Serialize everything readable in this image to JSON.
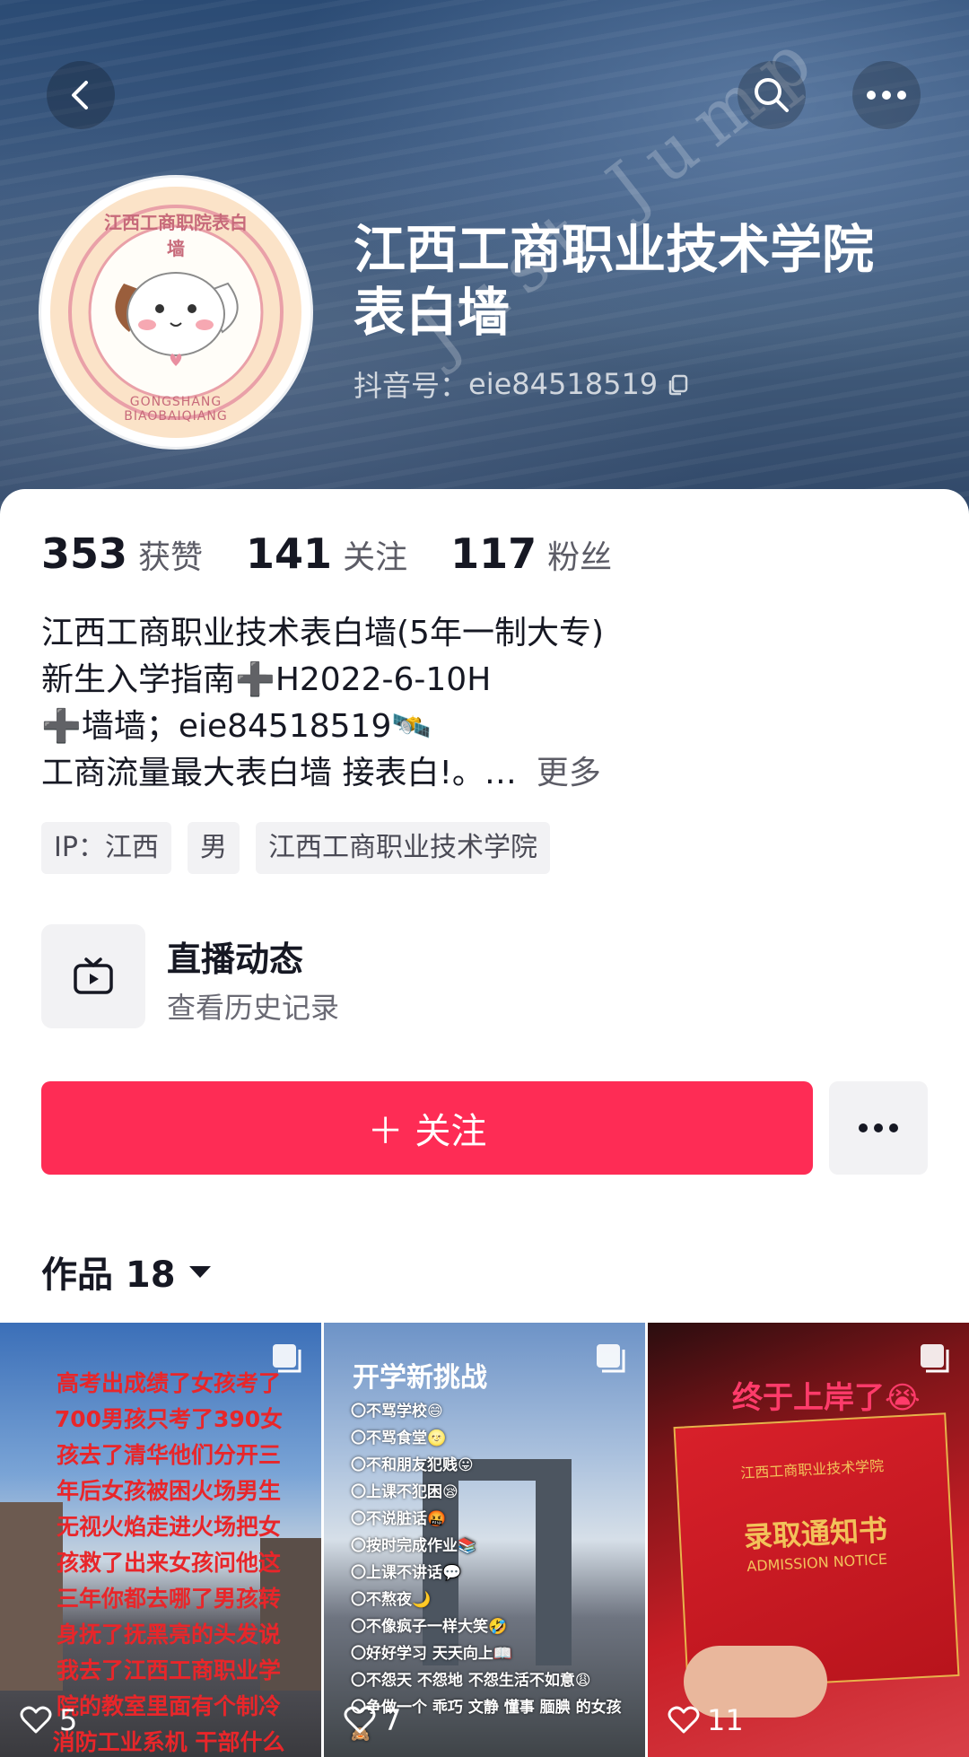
{
  "header": {
    "title_line1": "江西工商职业技术学院",
    "title_line2": "表白墙",
    "douyin_id_label": "抖音号：",
    "douyin_id_value": "eie84518519",
    "watermark": "Just Jump",
    "back_icon": "back-arrow-icon",
    "search_icon": "search-icon",
    "more_icon": "more-dots-icon",
    "avatar": {
      "top_text": "江西工商职院表白墙",
      "bottom_text": "GONGSHANG BIAOBAIQIANG"
    }
  },
  "stats": [
    {
      "value": "353",
      "label": "获赞"
    },
    {
      "value": "141",
      "label": "关注"
    },
    {
      "value": "117",
      "label": "粉丝"
    }
  ],
  "bio": {
    "line1": "江西工商职业技术表白墙(5年一制大专)",
    "line2": "新生入学指南➕H2022-6-10H",
    "line3": "➕墙墙；eie84518519🛰️",
    "line4": "工商流量最大表白墙  接表白!。…",
    "more_label": "更多"
  },
  "tags": [
    "IP：江西",
    "男",
    "江西工商职业技术学院"
  ],
  "live": {
    "title": "直播动态",
    "subtitle": "查看历史记录"
  },
  "actions": {
    "follow_label": "＋ 关注"
  },
  "works": {
    "tab_label": "作品 18",
    "items": [
      {
        "likes": "5",
        "overlay_text": "高考出成绩了女孩考了700男孩只考了390女孩去了清华他们分开三年后女孩被困火场男生无视火焰走进火场把女孩救了出来女孩问他这三年你都去哪了男孩转身抚了抚黑亮的头发说我去了江西工商职业学院的教室里面有个制冷消防工业系机 干部什么卫生间"
      },
      {
        "likes": "7",
        "heading": "开学新挑战",
        "list": [
          "〇不骂学校😄",
          "〇不骂食堂🌝",
          "〇不和朋友犯贱😛",
          "〇上课不犯困😪",
          "〇不说脏话🤬",
          "〇按时完成作业📚",
          "〇上课不讲话💬",
          "〇不熬夜🌙",
          "〇不像疯子一样大笑🤣",
          "〇好好学习 天天向上📖",
          "〇不怨天 不怨地 不怨生活不如意😩",
          "〇争做一个 乖巧 文静 懂事 腼腆 的女孩🙈"
        ]
      },
      {
        "likes": "11",
        "heading": "终于上岸了😭",
        "school": "江西工商职业技术学院",
        "notice": "录取通知书",
        "notice_en": "ADMISSION NOTICE"
      }
    ]
  },
  "colors": {
    "accent": "#fe2c55",
    "text_primary": "#161823",
    "text_secondary": "#5c5c66",
    "tag_bg": "#f2f2f4"
  }
}
